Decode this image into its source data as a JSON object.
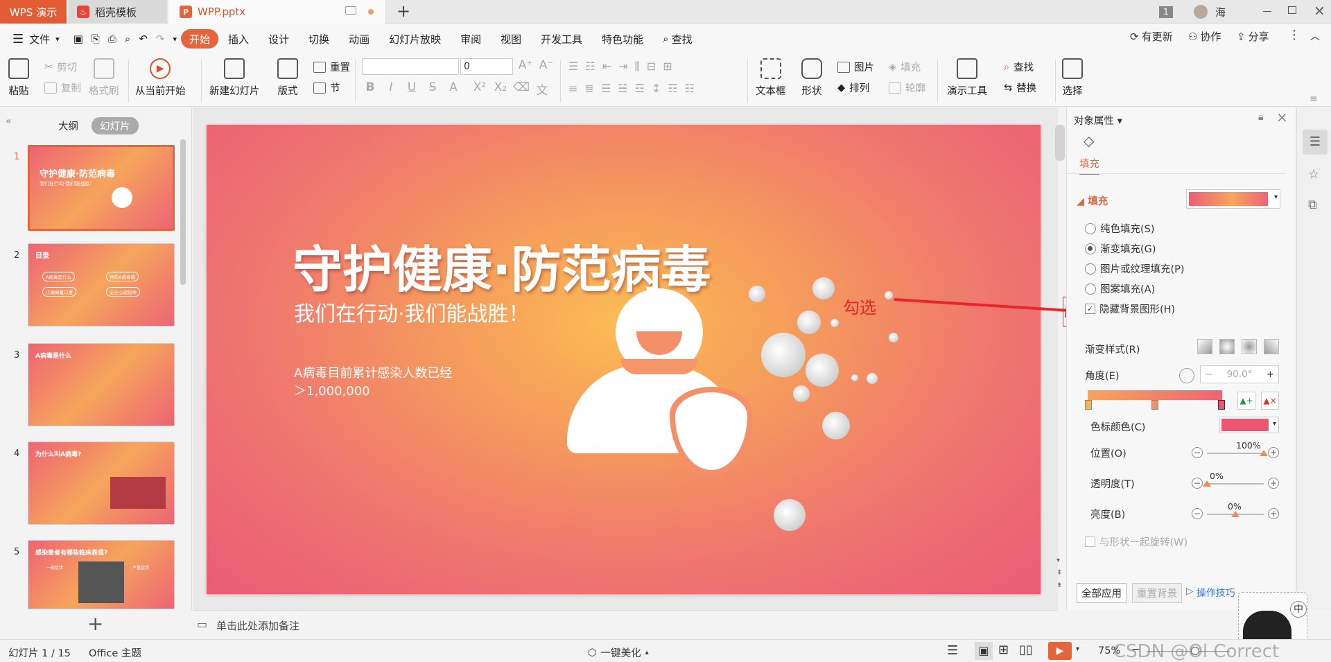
{
  "tabs": {
    "app": "WPS 演示",
    "template": "稻壳模板",
    "file": "WPP.pptx",
    "badge": "1",
    "user": "海"
  },
  "menu": {
    "file": "文件",
    "items": [
      "开始",
      "插入",
      "设计",
      "切换",
      "动画",
      "幻灯片放映",
      "审阅",
      "视图",
      "开发工具",
      "特色功能"
    ],
    "search": "查找",
    "update": "有更新",
    "collab": "协作",
    "share": "分享"
  },
  "ribbon": {
    "paste": "粘贴",
    "cut": "剪切",
    "copy": "复制",
    "format_painter": "格式刷",
    "from_current": "从当前开始",
    "new_slide": "新建幻灯片",
    "layout": "版式",
    "reset": "重置",
    "section": "节",
    "font_size": "0",
    "textbox": "文本框",
    "shape": "形状",
    "picture": "图片",
    "fill": "填充",
    "arrange": "排列",
    "outline": "轮廓",
    "present_tools": "演示工具",
    "find": "查找",
    "replace": "替换",
    "select": "选择"
  },
  "left": {
    "outline_tab": "大纲",
    "slides_tab": "幻灯片",
    "add": "+"
  },
  "thumbs": [
    {
      "num": "1",
      "title": "守护健康·防范病毒",
      "sub": "我们在行动·我们能战胜！"
    },
    {
      "num": "2",
      "title": "目录",
      "items": [
        "A病毒是什么",
        "预防A病毒病",
        "正确佩戴口罩",
        "安全心理指导"
      ]
    },
    {
      "num": "3",
      "title": "A病毒是什么"
    },
    {
      "num": "4",
      "title": "为什么叫A病毒?"
    },
    {
      "num": "5",
      "title": "感染患者有哪些临床表现?",
      "cols": [
        "一般症状",
        "严重症状"
      ]
    }
  ],
  "slide": {
    "title": "守护健康·防范病毒",
    "subtitle": "我们在行动·我们能战胜！",
    "body_line1": "A病毒目前累计感染人数已经",
    "body_line2": "＞1,000,000"
  },
  "annotation": {
    "label": "勾选"
  },
  "props": {
    "header": "对象属性",
    "tab": "填充",
    "section": "填充",
    "options": [
      "纯色填充(S)",
      "渐变填充(G)",
      "图片或纹理填充(P)",
      "图案填充(A)"
    ],
    "selected": 1,
    "hide_bg": "隐藏背景图形(H)",
    "hide_bg_checked": true,
    "grad_style": "渐变样式(R)",
    "angle_label": "角度(E)",
    "angle_value": "90.0°",
    "stop_color": "色标颜色(C)",
    "position_label": "位置(O)",
    "position_value": "100%",
    "position_level": 1.0,
    "transparency_label": "透明度(T)",
    "transparency_value": "0%",
    "transparency_level": 0.0,
    "brightness_label": "亮度(B)",
    "brightness_value": "0%",
    "brightness_level": 0.5,
    "rotate_with_shape": "与形状一起旋转(W)",
    "apply_all": "全部应用",
    "reset_bg": "重置背景",
    "tips": "操作技巧"
  },
  "colors": {
    "accent": "#e4643c",
    "grad_start": "#f6a55c",
    "grad_end": "#ec6475",
    "arrow": "#e8262a",
    "stop_color": "#ec5670"
  },
  "notes": {
    "placeholder": "单击此处添加备注"
  },
  "status": {
    "slide_count": "幻灯片 1 / 15",
    "theme": "Office 主题",
    "beautify": "一键美化",
    "zoom": "75%",
    "ime": "中",
    "watermark": "CSDN @Ol Correct"
  }
}
